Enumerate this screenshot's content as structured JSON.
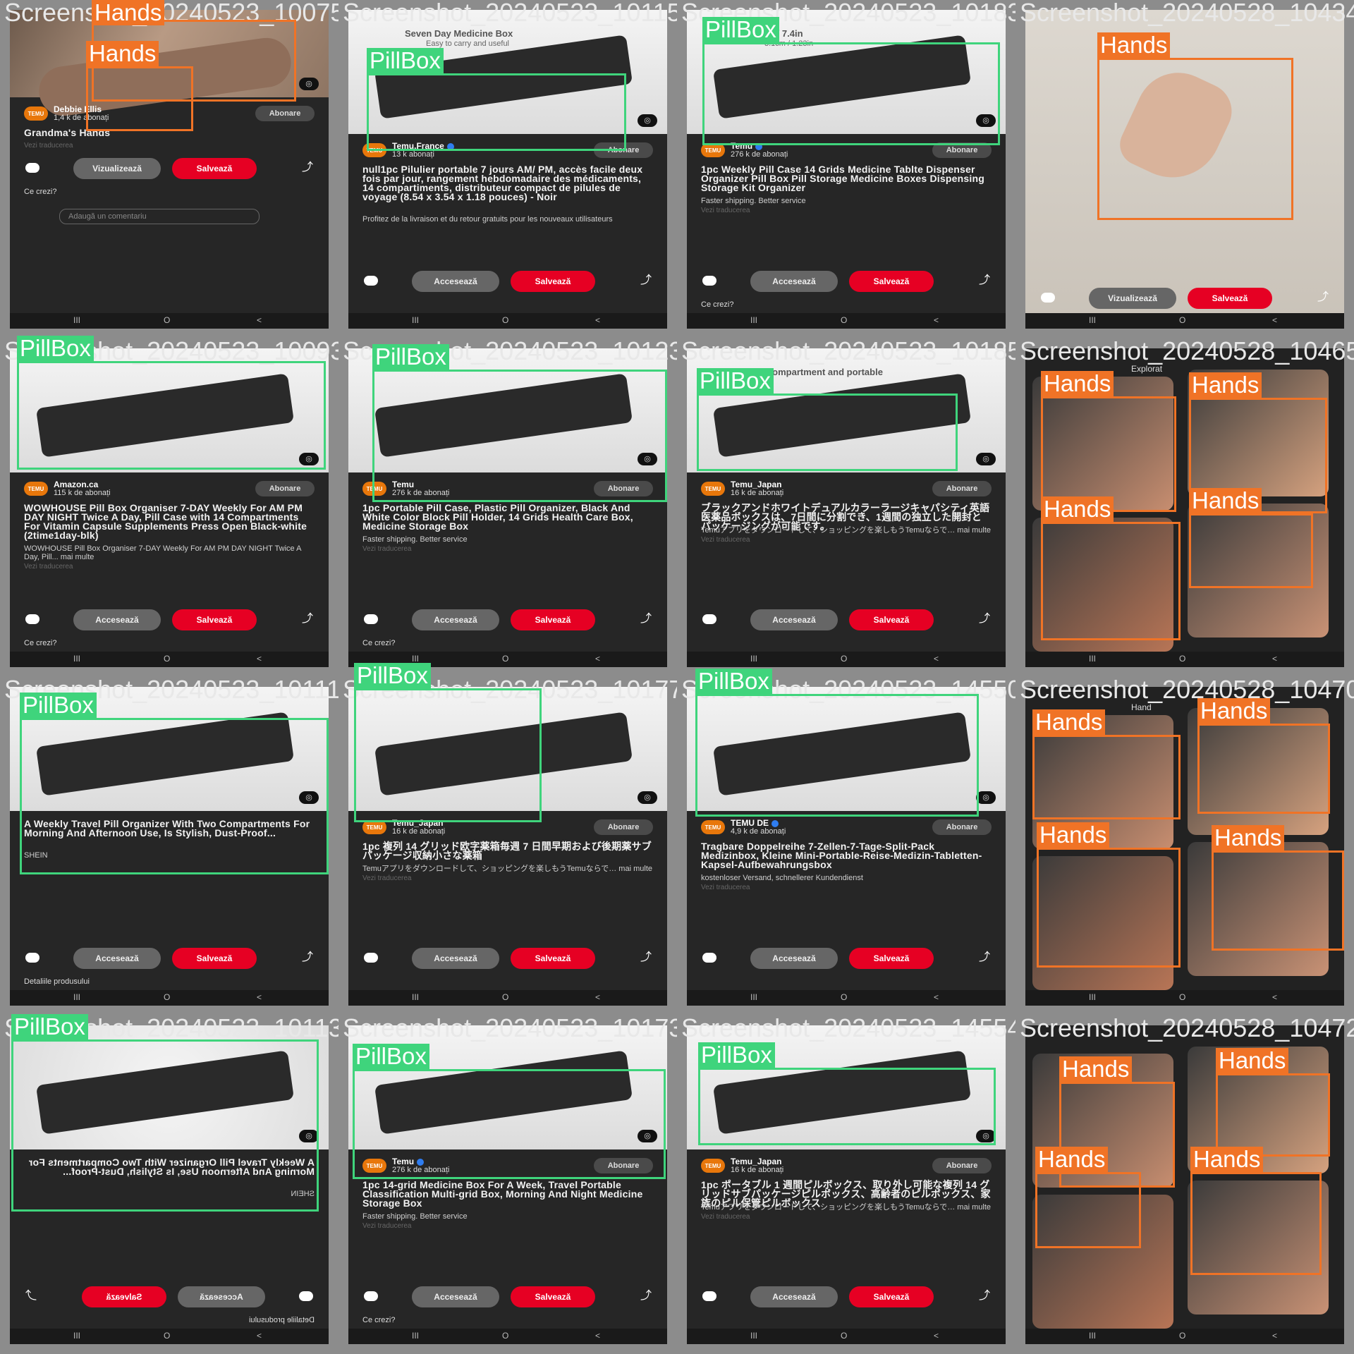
{
  "colors": {
    "pillbox": "#3fd47c",
    "hands": "#f07326",
    "save_button": "#e60023"
  },
  "icons": [
    "comment-icon",
    "share-icon",
    "lens-search-icon",
    "verified-icon",
    "heart-icon"
  ],
  "navbar": {
    "recents": "III",
    "home": "O",
    "back": "<"
  },
  "tiles": [
    {
      "filename": "Screenshot_20240523_100755",
      "variant": "hands_single",
      "channel": "Debbie Ellis",
      "subs": "1,4 k de abonați",
      "verified": false,
      "title": "Grandma's Hands",
      "desc": "",
      "vezi": "Vezi traducerea",
      "btn1": "Vizualizează",
      "btn2": "Salvează",
      "ce": "Ce crezi?",
      "comment_placeholder": "Adaugă un comentariu",
      "detections": [
        "Hands",
        "Hands"
      ]
    },
    {
      "filename": "Screenshot_20240523_101155",
      "variant": "pill",
      "channel": "Temu.France",
      "subs": "13 k abonați",
      "verified": true,
      "title": "null1pc Pilulier portable 7 jours AM/ PM, accès facile deux fois par jour, rangement hebdomadaire des médicaments, 14 compartiments, distributeur compact de pilules de voyage (8.54 x 3.54 x 1.18 pouces) - Noir",
      "desc": "Profitez de la livraison et du retour gratuits pour les nouveaux utilisateurs",
      "vezi": "",
      "btn1": "Accesează",
      "btn2": "Salvează",
      "ce": "",
      "photo_text": "Seven Day Medicine Box",
      "photo_subtext": "Easy to carry and useful",
      "detections": [
        "PillBox"
      ]
    },
    {
      "filename": "Screenshot_20240523_101830",
      "variant": "pill",
      "channel": "Temu",
      "subs": "276 k de abonați",
      "verified": true,
      "title": "1pc Weekly Pill Case 14 Grids Medicine Tablte Dispenser Organizer Pill Box Pill Storage Medicine Boxes Dispensing Storage Kit Organizer",
      "desc": "Faster shipping. Better service",
      "vezi": "Vezi traducerea",
      "btn1": "Accesează",
      "btn2": "Salvează",
      "ce": "Ce crezi?",
      "photo_text": "18.8cm / 7.4in",
      "photo_subtext": "3.1cm / 1.23in",
      "detections": [
        "PillBox"
      ]
    },
    {
      "filename": "Screenshot_20240528_104340",
      "variant": "hands_full",
      "btn1": "Vizualizează",
      "btn2": "Salvează",
      "detections": [
        "Hands"
      ]
    },
    {
      "filename": "Screenshot_20240523_100936",
      "variant": "pill",
      "channel": "Amazon.ca",
      "subs": "115 k de abonați",
      "verified": false,
      "title": "WOWHOUSE Pill Box Organiser 7-DAY Weekly For AM PM DAY NIGHT Twice A Day, Pill Case with 14 Compartments For Vitamin Capsule Supplements Press Open Black-white (2time1day-blk)",
      "desc": "WOWHOUSE Pill Box Organiser 7-DAY Weekly For AM PM DAY NIGHT Twice A Day, Pill... mai multe",
      "vezi": "Vezi traducerea",
      "btn1": "Accesează",
      "btn2": "Salvează",
      "ce": "Ce crezi?",
      "detections": [
        "PillBox"
      ]
    },
    {
      "filename": "Screenshot_20240523_101237",
      "variant": "pill",
      "channel": "Temu",
      "subs": "276 k de abonați",
      "verified": false,
      "title": "1pc Portable Pill Case, Plastic Pill Organizer, Black And White Color Block Pill Holder, 14 Grids Health Care Box, Medicine Storage Box",
      "desc": "Faster shipping. Better service",
      "vezi": "Vezi traducerea",
      "btn1": "Accesează",
      "btn2": "Salvează",
      "ce": "Ce crezi?",
      "detections": [
        "PillBox"
      ]
    },
    {
      "filename": "Screenshot_20240523_101853",
      "variant": "pill",
      "channel": "Temu_Japan",
      "subs": "16 k de abonați",
      "verified": false,
      "title": "ブラックアンドホワイトデュアルカラーラージキャパシティ英語医薬品ボックスは、7日間に分割でき、1週間の独立した開封とパッケージングが可能です。",
      "desc": "Temuアプリをダウンロードして、ショッピングを楽しもうTemuならで… mai multe",
      "vezi": "Vezi traducerea",
      "btn1": "Accesează",
      "btn2": "Salvează",
      "ce": "",
      "photo_text": "ble 7-compartment and portable",
      "detections": [
        "PillBox"
      ]
    },
    {
      "filename": "Screenshot_20240528_104653",
      "variant": "hands_grid",
      "photo_text": "Explorat",
      "detections": [
        "Hands",
        "Hands",
        "Hands",
        "Hands"
      ]
    },
    {
      "filename": "Screenshot_20240523_101118",
      "variant": "pill",
      "channel": "",
      "subs": "",
      "verified": false,
      "title": "A Weekly Travel Pill Organizer With Two Compartments For Morning And Afternoon Use, Is Stylish, Dust-Proof...",
      "desc": "SHEIN",
      "vezi": "",
      "btn1": "Accesează",
      "btn2": "Salvează",
      "ce": "Detaliile produsului",
      "detections": [
        "PillBox"
      ]
    },
    {
      "filename": "Screenshot_20240523_101773",
      "variant": "pill",
      "channel": "Temu_Japan",
      "subs": "16 k de abonați",
      "verified": false,
      "title": "1pc 複列 14 グリッド欧字薬箱毎週 7 日間早期および後期薬サブパッケージ収納小さな薬箱",
      "desc": "Temuアプリをダウンロードして、ショッピングを楽しもうTemuならで… mai multe",
      "vezi": "Vezi traducerea",
      "btn1": "Accesează",
      "btn2": "Salvează",
      "ce": "",
      "detections": [
        "PillBox"
      ]
    },
    {
      "filename": "Screenshot_20240523_145508",
      "variant": "pill",
      "channel": "TEMU DE",
      "subs": "4,9 k de abonați",
      "verified": true,
      "title": "Tragbare Doppelreihe 7-Zellen-7-Tage-Split-Pack Medizinbox, Kleine Mini-Portable-Reise-Medizin-Tabletten-Kapsel-Aufbewahrungsbox",
      "desc": "kostenloser Versand, schnellerer Kundendienst",
      "vezi": "Vezi traducerea",
      "btn1": "Accesează",
      "btn2": "Salvează",
      "ce": "",
      "detections": [
        "PillBox"
      ]
    },
    {
      "filename": "Screenshot_20240528_104708",
      "variant": "hands_grid",
      "photo_text": "Hand",
      "detections": [
        "Hands",
        "Hands",
        "Hands",
        "Hands"
      ]
    },
    {
      "filename": "Screenshot_20240523_101134",
      "variant": "pill_mirror",
      "channel": "",
      "subs": "",
      "verified": false,
      "title": "A Weekly Travel Pill Organizer With Two Compartments For Morning And Afternoon Use, Is Stylish, Dust-Proof...",
      "desc": "SHEIN",
      "vezi": "",
      "btn1": "Accesează",
      "btn2": "Salvează",
      "ce": "Detaliile produsului",
      "detections": [
        "PillBox"
      ]
    },
    {
      "filename": "Screenshot_20240523_101735",
      "variant": "pill",
      "channel": "Temu",
      "subs": "276 k de abonați",
      "verified": true,
      "title": "1pc 14-grid Medicine Box For A Week, Travel Portable Classification Multi-grid Box, Morning And Night Medicine Storage Box",
      "desc": "Faster shipping. Better service",
      "vezi": "Vezi traducerea",
      "btn1": "Accesează",
      "btn2": "Salvează",
      "ce": "Ce crezi?",
      "detections": [
        "PillBox"
      ]
    },
    {
      "filename": "Screenshot_20240523_145540",
      "variant": "pill",
      "channel": "Temu_Japan",
      "subs": "16 k de abonați",
      "verified": false,
      "title": "1pc ポータブル 1 週間ピルボックス、取り外し可能な複列 14 グリッドサブパッケージピルボックス、高齢者のピルボックス、家族のピル保管ピルボックス",
      "desc": "Temuアプリをダウンロードして、ショッピングを楽しもうTemuならで… mai multe",
      "vezi": "Vezi traducerea",
      "btn1": "Accesează",
      "btn2": "Salvează",
      "ce": "",
      "detections": [
        "PillBox"
      ]
    },
    {
      "filename": "Screenshot_20240528_104720",
      "variant": "hands_grid",
      "photo_text": "",
      "detections": [
        "Hands",
        "Hands",
        "Hands",
        "Hands"
      ]
    }
  ]
}
